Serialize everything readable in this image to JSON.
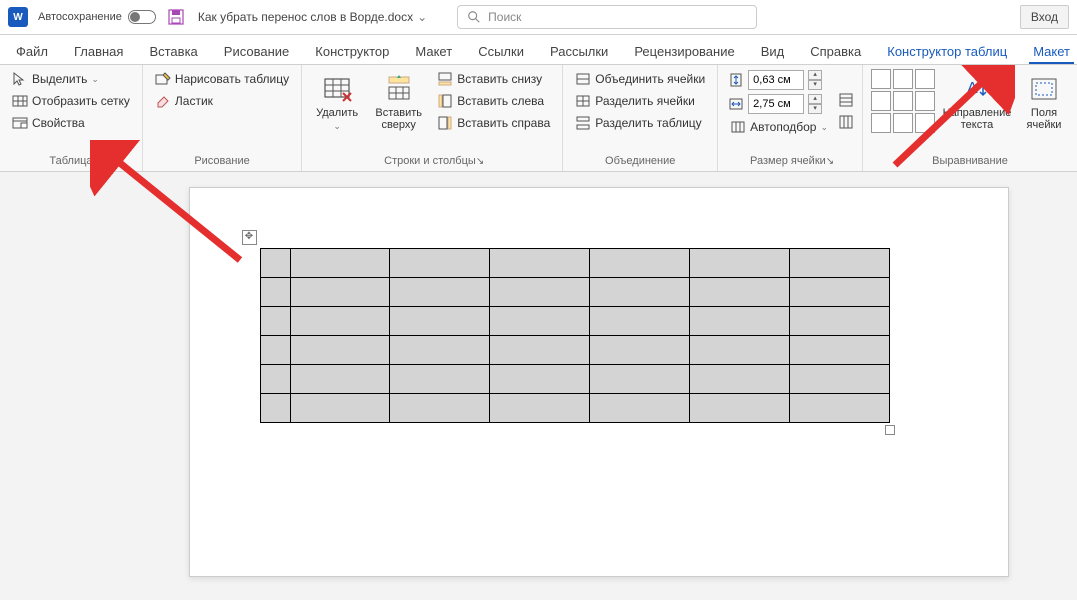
{
  "title_bar": {
    "app_letter": "W",
    "autosave_label": "Автосохранение",
    "doc_title": "Как убрать перенос слов в Ворде.docx",
    "search_placeholder": "Поиск",
    "login": "Вход"
  },
  "tabs": {
    "file": "Файл",
    "home": "Главная",
    "insert": "Вставка",
    "draw": "Рисование",
    "design": "Конструктор",
    "layout": "Макет",
    "references": "Ссылки",
    "mailings": "Рассылки",
    "review": "Рецензирование",
    "view": "Вид",
    "help": "Справка",
    "table_design": "Конструктор таблиц",
    "table_layout": "Макет"
  },
  "ribbon": {
    "table": {
      "select": "Выделить",
      "gridlines": "Отобразить сетку",
      "properties": "Свойства",
      "group": "Таблица"
    },
    "drawing": {
      "draw_table": "Нарисовать таблицу",
      "eraser": "Ластик",
      "group": "Рисование"
    },
    "rows_cols": {
      "delete": "Удалить",
      "insert_above": "Вставить сверху",
      "insert_below": "Вставить снизу",
      "insert_left": "Вставить слева",
      "insert_right": "Вставить справа",
      "group": "Строки и столбцы"
    },
    "merge": {
      "merge_cells": "Объединить ячейки",
      "split_cells": "Разделить ячейки",
      "split_table": "Разделить таблицу",
      "group": "Объединение"
    },
    "cell_size": {
      "height": "0,63 см",
      "width": "2,75 см",
      "autofit": "Автоподбор",
      "group": "Размер ячейки"
    },
    "alignment": {
      "text_direction": "Направление текста",
      "cell_margins": "Поля ячейки",
      "group": "Выравнивание"
    }
  },
  "table_data": {
    "rows": 6,
    "cols": 7
  },
  "colors": {
    "accent": "#185abd",
    "arrow": "#e52e2e"
  }
}
